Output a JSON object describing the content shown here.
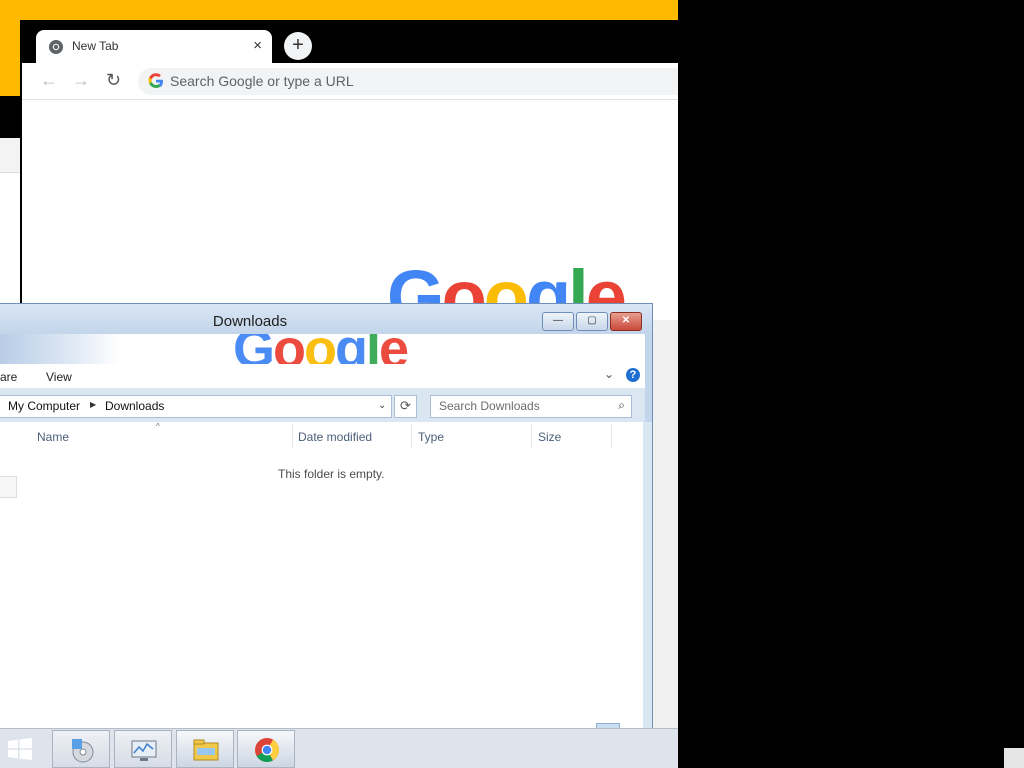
{
  "chrome": {
    "tab_title": "New Tab",
    "tab_close": "×",
    "new_tab": "+",
    "back": "←",
    "forward": "→",
    "reload": "↻",
    "omnibox_placeholder": "Search Google or type a URL",
    "logo": [
      "G",
      "o",
      "o",
      "g",
      "l",
      "e"
    ],
    "logo_colors": [
      "#4285F4",
      "#EA4335",
      "#FBBC05",
      "#4285F4",
      "#34A853",
      "#EA4335"
    ]
  },
  "explorer": {
    "title": "Downloads",
    "buttons": {
      "minimize": "—",
      "maximize": "▢",
      "close": "✕"
    },
    "menu": {
      "share": "are",
      "view": "View",
      "chevron": "⌄",
      "help": "?"
    },
    "breadcrumbs": [
      "My Computer",
      "Downloads"
    ],
    "breadcrumb_sep": "▶",
    "dropdown": "⌄",
    "refresh": "⟳",
    "search_placeholder": "Search Downloads",
    "columns": [
      "Name",
      "Date modified",
      "Type",
      "Size"
    ],
    "sort_indicator": "^",
    "empty_message": "This folder is empty."
  },
  "taskbar": {
    "items": [
      "start-button",
      "media-center-icon",
      "performance-monitor-icon",
      "file-explorer-icon",
      "chrome-icon"
    ]
  },
  "colors": {
    "desktop_accent": "#FFB900",
    "explorer_frame": "#c3d5ea",
    "taskbar": "#dfe4ec"
  }
}
